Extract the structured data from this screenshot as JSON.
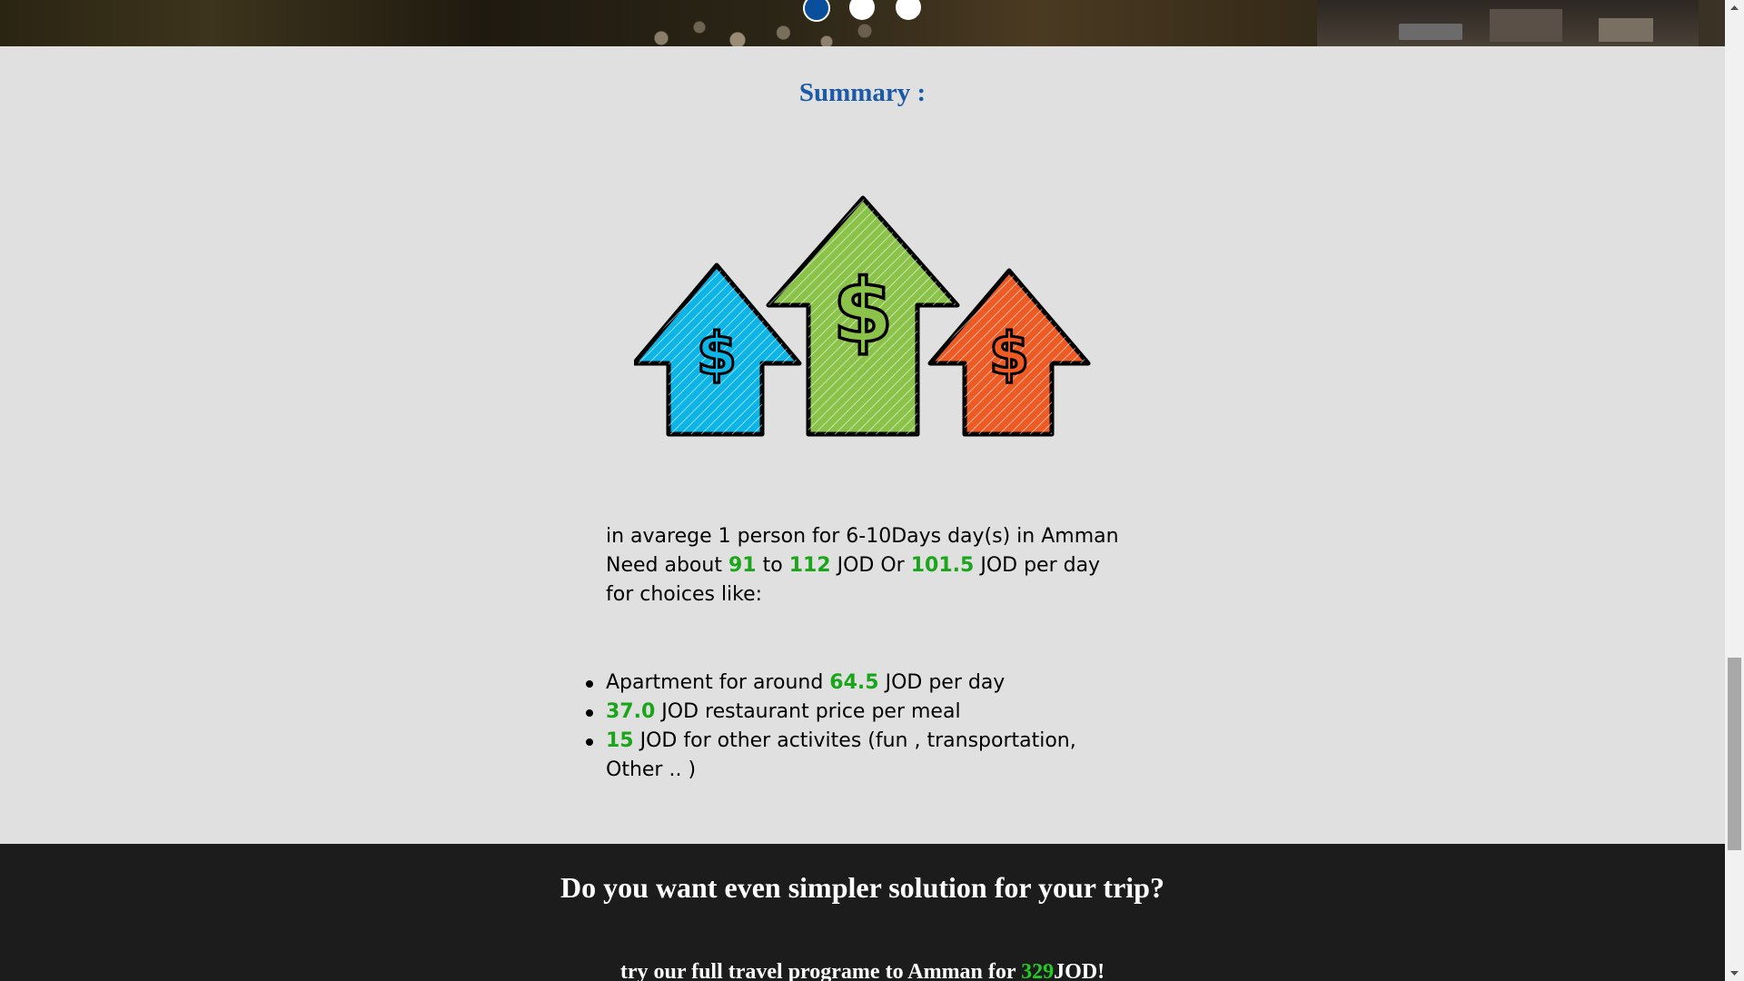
{
  "carousel": {
    "slides": [
      "slide 1",
      "slide 2",
      "slide 3"
    ],
    "active_index": 0
  },
  "summary": {
    "title": "Summary :",
    "illustration": {
      "icons": [
        "dollar-arrow-blue-icon",
        "dollar-arrow-green-icon",
        "dollar-arrow-orange-icon"
      ],
      "colors": {
        "blue": "#0db4e6",
        "green": "#8bc34a",
        "orange": "#ee5a24"
      }
    },
    "intro_line": "in avarege 1 person for 6-10Days day(s) in Amman",
    "need_prefix": "Need about",
    "min_value": "91",
    "to_word": "to",
    "max_value": "112",
    "or_text": "JOD Or",
    "avg_value": "101.5",
    "per_day_suffix": "JOD per day",
    "choices_line": "for choices like:",
    "items": [
      {
        "before": "Apartment for around",
        "value": "64.5",
        "after": "JOD per day"
      },
      {
        "before": "",
        "value": "37.0",
        "after": "JOD restaurant price per meal"
      },
      {
        "before": "",
        "value": "15",
        "after": "JOD for other activites (fun , transportation, Other .. )"
      }
    ]
  },
  "footer": {
    "heading": "Do you want even simpler solution for your trip?",
    "offer_prefix": "try our full travel programe to Amman for",
    "offer_price": "329",
    "offer_suffix": "JOD!"
  },
  "colors": {
    "title_blue": "#1a5aa6",
    "value_green": "#1aa51a",
    "footer_bg": "#1c1c1c",
    "page_bg": "#e0e0e0",
    "carousel_active": "#0a4f9c"
  }
}
